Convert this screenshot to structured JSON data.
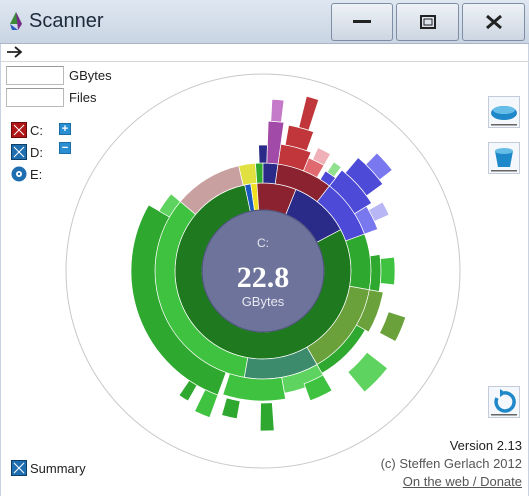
{
  "window": {
    "title": "Scanner"
  },
  "stats": {
    "gbytes_value": "",
    "gbytes_label": "GBytes",
    "files_value": "",
    "files_label": "Files"
  },
  "drives": [
    {
      "label": "C:",
      "icon": "drive-c-icon",
      "color": "#b01616"
    },
    {
      "label": "D:",
      "icon": "drive-d-icon",
      "color": "#1f6fb0"
    },
    {
      "label": "E:",
      "icon": "cd-drive-icon",
      "color": "#1f6fb0"
    }
  ],
  "expand_buttons": {
    "plus": "+",
    "minus": "−"
  },
  "center": {
    "drive": "C:",
    "value": "22.8",
    "unit": "GBytes"
  },
  "info": {
    "version": "Version 2.13",
    "copyright": "(c) Steffen Gerlach 2012",
    "link": "On the web / Donate"
  },
  "summary_label": "Summary",
  "colors": {
    "green": "#2ea82e",
    "dark_green": "#2a7a2a",
    "red": "#c0363a",
    "blue": "#4e4ad8",
    "magenta": "#a24aa8",
    "center_fill": "#6d739a"
  }
}
